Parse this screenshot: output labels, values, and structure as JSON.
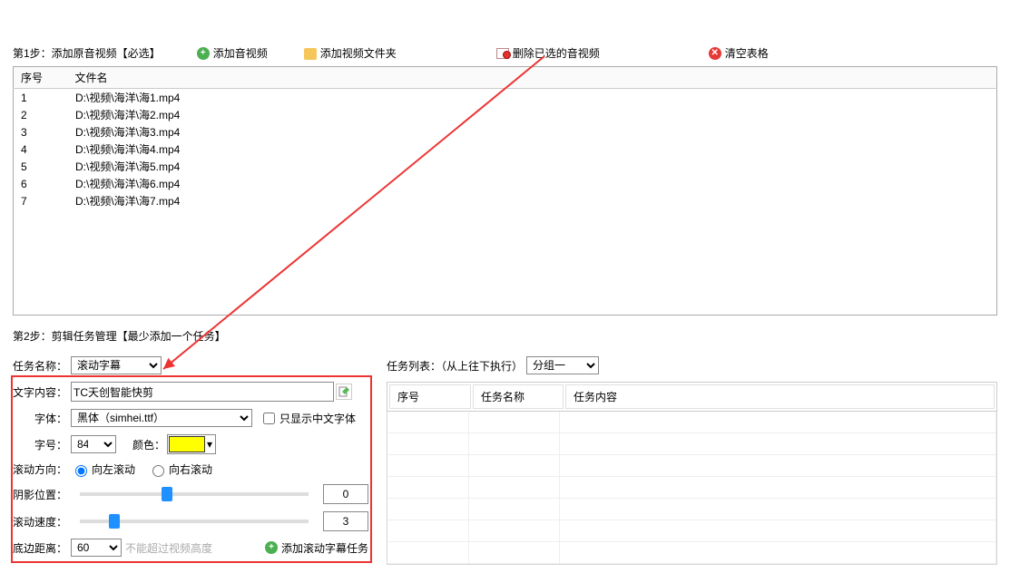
{
  "step1": {
    "title": "第1步：添加原音视频【必选】",
    "btn_add_av": "添加音视频",
    "btn_add_folder": "添加视频文件夹",
    "btn_del_sel": "删除已选的音视频",
    "btn_clear": "清空表格"
  },
  "file_table": {
    "col_num": "序号",
    "col_filename": "文件名",
    "rows": [
      {
        "num": "1",
        "filename": "D:\\视频\\海洋\\海1.mp4"
      },
      {
        "num": "2",
        "filename": "D:\\视频\\海洋\\海2.mp4"
      },
      {
        "num": "3",
        "filename": "D:\\视频\\海洋\\海3.mp4"
      },
      {
        "num": "4",
        "filename": "D:\\视频\\海洋\\海4.mp4"
      },
      {
        "num": "5",
        "filename": "D:\\视频\\海洋\\海5.mp4"
      },
      {
        "num": "6",
        "filename": "D:\\视频\\海洋\\海6.mp4"
      },
      {
        "num": "7",
        "filename": "D:\\视频\\海洋\\海7.mp4"
      }
    ]
  },
  "step2": {
    "title": "第2步：剪辑任务管理【最少添加一个任务】",
    "task_name_label": "任务名称：",
    "task_name_value": "滚动字幕",
    "task_list_label": "任务列表：（从上往下执行）",
    "task_group_value": "分组一"
  },
  "form": {
    "text_content_label": "文字内容：",
    "text_content_value": "TC天创智能快剪",
    "font_label": "字体：",
    "font_value": "黑体（simhei.ttf）",
    "only_cn_label": "只显示中文字体",
    "size_label": "字号：",
    "size_value": "84",
    "color_label": "颜色：",
    "color_value": "#ffff00",
    "direction_label": "滚动方向：",
    "dir_left": "向左滚动",
    "dir_right": "向右滚动",
    "shadow_label": "阴影位置：",
    "shadow_value": "0",
    "speed_label": "滚动速度：",
    "speed_value": "3",
    "margin_label": "底边距离：",
    "margin_value": "60",
    "margin_hint": "不能超过视频高度",
    "add_task_btn": "添加滚动字幕任务"
  },
  "task_table": {
    "col_num": "序号",
    "col_name": "任务名称",
    "col_content": "任务内容"
  },
  "slider": {
    "shadow_pct": 38,
    "speed_pct": 15
  }
}
